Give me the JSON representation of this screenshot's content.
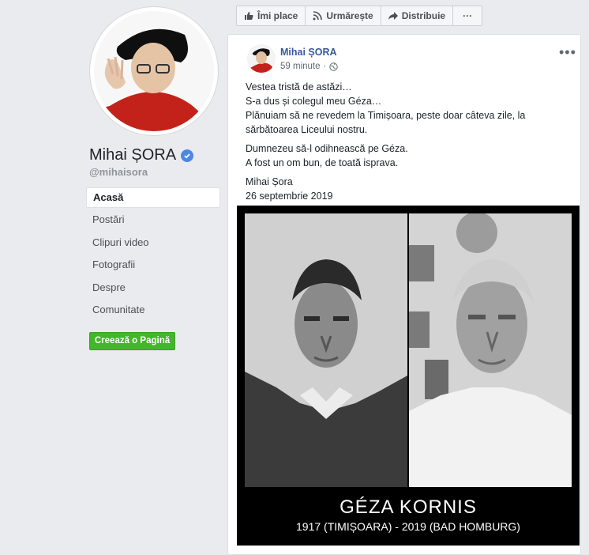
{
  "profile": {
    "name": "Mihai ȘORA",
    "handle": "@mihaisora"
  },
  "nav": {
    "items": [
      {
        "label": "Acasă",
        "active": true
      },
      {
        "label": "Postări"
      },
      {
        "label": "Clipuri video"
      },
      {
        "label": "Fotografii"
      },
      {
        "label": "Despre"
      },
      {
        "label": "Comunitate"
      }
    ],
    "create_page": "Creează o Pagină"
  },
  "actions": {
    "like": "Îmi place",
    "follow": "Urmărește",
    "share": "Distribuie",
    "more": "···"
  },
  "post": {
    "author": "Mihai ȘORA",
    "time": "59 minute",
    "more": "•••",
    "paragraphs": [
      [
        "Vestea tristă de astăzi…",
        "S-a dus și colegul meu Géza…",
        "Plănuiam să ne revedem la Timișoara, peste doar câteva zile, la",
        "sărbătoarea Liceului nostru."
      ],
      [
        "Dumnezeu să-l odihnească pe Géza.",
        "A fost un om bun, de toată isprava."
      ],
      [
        "Mihai Șora",
        "26 septembrie 2019"
      ]
    ],
    "image": {
      "title": "GÉZA KORNIS",
      "subtitle": "1917 (TIMIȘOARA) - 2019 (BAD HOMBURG)"
    }
  },
  "colors": {
    "background": "#e9ebee",
    "link": "#365899",
    "green": "#42b72a",
    "verified": "#4b88e6"
  }
}
